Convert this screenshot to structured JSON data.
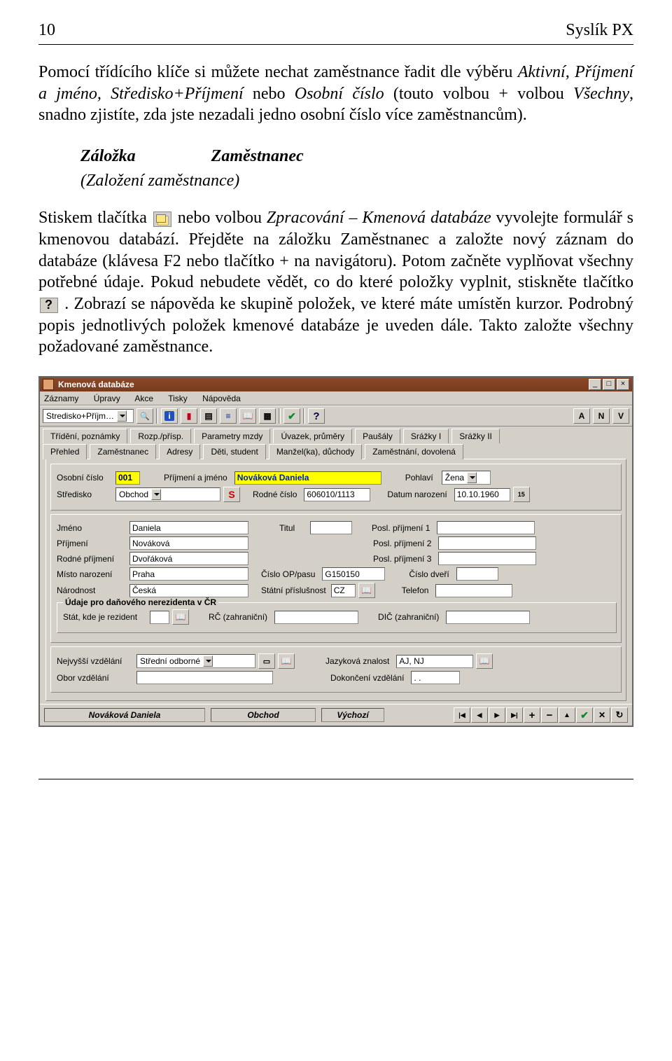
{
  "pageNumber": "10",
  "appTitle": "Syslík PX",
  "para1a": "Pomocí třídícího klíče si můžete nechat zaměstnance řadit dle výběru ",
  "para1b": "Aktivní, Příjmení a jméno, Středisko+Příjmení",
  "para1c": " nebo ",
  "para1d": "Osobní číslo",
  "para1e": " (touto volbou + volbou ",
  "para1f": "Všechny",
  "para1g": ", snadno zjistíte, zda jste nezadali jedno osobní číslo více zaměstnancům).",
  "secTitle1": "Záložka",
  "secTitle2": "Zaměstnanec",
  "secSub": "(Založení zaměstnance)",
  "para2a": "Stiskem tlačítka ",
  "para2b": " nebo volbou ",
  "para2c": "Zpracování – Kmenová databáze",
  "para2d": " vyvolejte formulář s kmenovou databází. Přejděte na záložku Zaměstnanec a založte nový záznam do databáze (klávesa F2 nebo tlačítko + na navigátoru). Potom začněte vyplňovat všechny potřebné údaje. Pokud nebudete vědět, co do které položky vyplnit, stiskněte tlačítko ",
  "para2e": " . Zobrazí se nápověda ke skupině položek, ve které máte umístěn kurzor. Podrobný popis jednotlivých položek kmenové databáze je uveden dále. Takto založte všechny požadované zaměstnance.",
  "win": {
    "title": "Kmenová databáze",
    "menu": [
      "Záznamy",
      "Úpravy",
      "Akce",
      "Tisky",
      "Nápověda"
    ],
    "sortCombo": "Stredisko+Příjm…",
    "rightBtns": [
      "A",
      "N",
      "V"
    ],
    "tabsTop": [
      "Třídění, poznámky",
      "Rozp./přísp.",
      "Parametry mzdy",
      "Úvazek, průměry",
      "Paušály",
      "Srážky I",
      "Srážky II"
    ],
    "tabsBottom": [
      "Přehled",
      "Zaměstnanec",
      "Adresy",
      "Děti, student",
      "Manžel(ka), důchody",
      "Zaměstnání, dovolená"
    ],
    "labels": {
      "osobniCislo": "Osobní číslo",
      "prijmeniJmeno": "Příjmení a jméno",
      "pohlavi": "Pohlaví",
      "stredisko": "Středisko",
      "rodneCislo": "Rodné číslo",
      "datumNarozeni": "Datum narození",
      "jmeno": "Jméno",
      "titul": "Titul",
      "poslPrijmeni1": "Posl. příjmení 1",
      "prijmeni": "Příjmení",
      "poslPrijmeni2": "Posl. příjmení 2",
      "rodnePrijmeni": "Rodné příjmení",
      "poslPrijmeni3": "Posl. příjmení 3",
      "mistoNarozeni": "Místo narození",
      "cisloOP": "Číslo OP/pasu",
      "cisloDveri": "Číslo dveří",
      "narodnost": "Národnost",
      "statniPrislusnost": "Státní příslušnost",
      "telefon": "Telefon",
      "nerezidentLegend": "Údaje pro daňového nerezidenta v ČR",
      "statRezident": "Stát, kde je rezident",
      "rcZahranicni": "RČ (zahraniční)",
      "dicZahranicni": "DIČ (zahraniční)",
      "nejvyssiVzdelani": "Nejvyšší vzdělání",
      "jazykovaZnalost": "Jazyková znalost",
      "oborVzdelani": "Obor vzdělání",
      "dokonceniVzdelani": "Dokončení vzdělání"
    },
    "values": {
      "osobniCislo": "001",
      "prijmeniJmeno": "Nováková Daniela",
      "pohlavi": "Žena",
      "stredisko": "Obchod",
      "rodneCislo": "606010/1113",
      "datumNarozeni": "10.10.1960",
      "jmeno": "Daniela",
      "titul": "",
      "poslPrijmeni1": "",
      "prijmeni": "Nováková",
      "poslPrijmeni2": "",
      "rodnePrijmeni": "Dvořáková",
      "poslPrijmeni3": "",
      "mistoNarozeni": "Praha",
      "cisloOP": "G150150",
      "cisloDveri": "",
      "narodnost": "Česká",
      "statniPrislusnost": "CZ",
      "telefon": "",
      "statRezident": "",
      "rcZahranicni": "",
      "dicZahranicni": "",
      "nejvyssiVzdelani": "Střední odborné",
      "jazykovaZnalost": "AJ, NJ",
      "oborVzdelani": "",
      "dokonceniVzdelani": "   .  ."
    },
    "status": {
      "name": "Nováková Daniela",
      "stredisko": "Obchod",
      "mode": "Výchozí"
    }
  }
}
